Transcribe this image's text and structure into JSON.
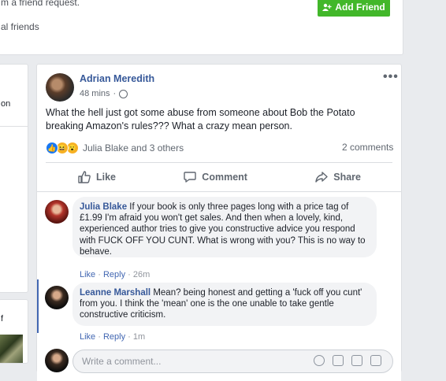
{
  "top_card": {
    "friend_request_text": "m a friend request.",
    "add_friend_label": "Add Friend",
    "mutual_text": "al friends"
  },
  "left": {
    "card1_text": "on",
    "card2_text": "f"
  },
  "post": {
    "author": "Adrian Meredith",
    "time": "48 mins",
    "separator": "·",
    "text": "What the hell just got some abuse from someone about Bob the Potato breaking Amazon's rules??? What a crazy mean person.",
    "reactions_text": "Julia Blake and 3 others",
    "comments_count": "2 comments",
    "actions": {
      "like": "Like",
      "comment": "Comment",
      "share": "Share"
    }
  },
  "comments": [
    {
      "name": "Julia Blake",
      "text": "If your book is only three pages long with a price tag of £1.99 I'm afraid you won't get sales. And then when a lovely, kind, experienced author tries to give you constructive advice you respond with FUCK OFF YOU CUNT. What is wrong with you? This is no way to behave.",
      "like": "Like",
      "reply": "Reply",
      "time": "26m"
    },
    {
      "name": "Leanne Marshall",
      "text": "Mean? being honest and getting a 'fuck off you cunt' from you. I think the 'mean' one is the one unable to take gentle constructive criticism.",
      "like": "Like",
      "reply": "Reply",
      "time": "1m"
    }
  ],
  "write_comment": {
    "placeholder": "Write a comment..."
  },
  "colors": {
    "link": "#365899",
    "green": "#42b72a",
    "accent": "#4267b2"
  }
}
